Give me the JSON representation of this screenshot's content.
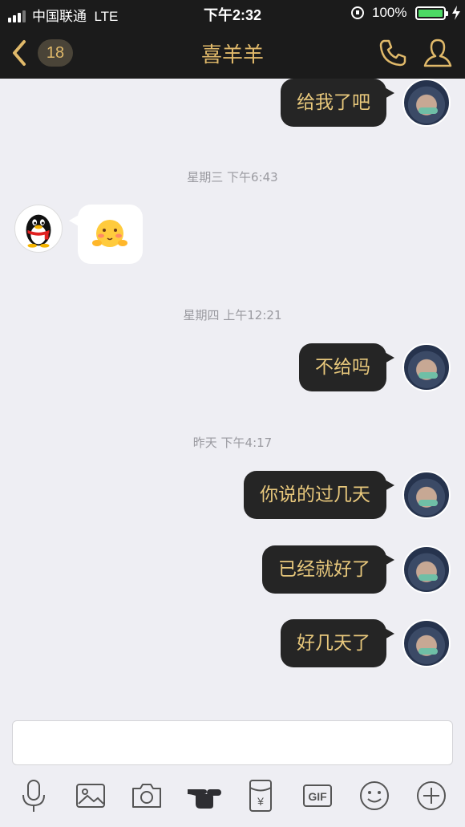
{
  "status_bar": {
    "carrier": "中国联通",
    "network": "LTE",
    "time": "下午2:32",
    "battery_percent": "100%",
    "battery_color": "#4cd964",
    "lock_icon": "orientation-lock-icon",
    "charging_icon": "charging-bolt-icon"
  },
  "nav": {
    "unread_count": "18",
    "title": "喜羊羊",
    "back_icon": "chevron-left-icon",
    "call_icon": "phone-icon",
    "profile_icon": "person-icon",
    "accent_color": "#e0b96a"
  },
  "messages": [
    {
      "sender": "me",
      "text": "给我了吧"
    },
    {
      "type": "timestamp",
      "text": "星期三 下午6:43"
    },
    {
      "sender": "other",
      "type": "sticker",
      "sticker": "shy-face-emoji"
    },
    {
      "type": "timestamp",
      "text": "星期四 上午12:21"
    },
    {
      "sender": "me",
      "text": "不给吗"
    },
    {
      "type": "timestamp",
      "text": "昨天 下午4:17"
    },
    {
      "sender": "me",
      "text": "你说的过几天"
    },
    {
      "sender": "me",
      "text": "已经就好了"
    },
    {
      "sender": "me",
      "text": "好几天了"
    }
  ],
  "toolbar": {
    "icons": [
      "microphone-icon",
      "image-icon",
      "camera-icon",
      "poke-hand-icon",
      "red-packet-icon",
      "gif-icon",
      "emoji-icon",
      "plus-icon"
    ],
    "gif_label": "GIF",
    "red_packet_label": "¥"
  }
}
